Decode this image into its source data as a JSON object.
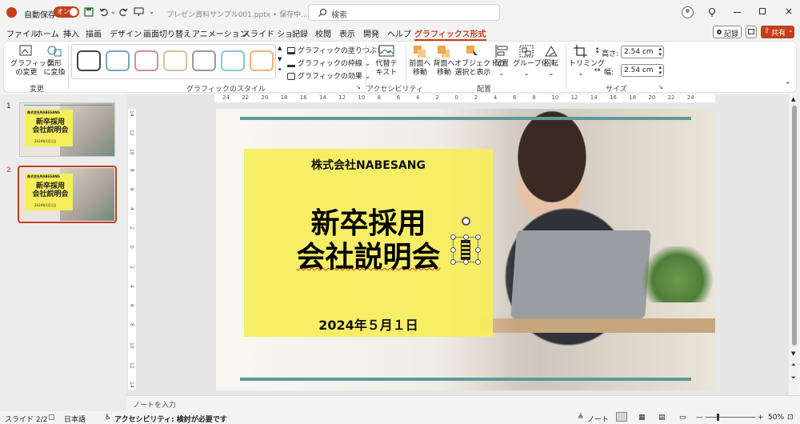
{
  "titlebar": {
    "autosave_label": "自動保存",
    "autosave_toggle": "オン",
    "doc_title": "プレゼン資料サンプル001.pptx • 保存中...",
    "search_placeholder": "検索"
  },
  "menu": {
    "tabs": [
      "ファイル",
      "ホーム",
      "挿入",
      "描画",
      "デザイン",
      "画面切り替え",
      "アニメーション",
      "スライド ショー",
      "記録",
      "校閲",
      "表示",
      "開発",
      "ヘルプ",
      "グラフィックス形式"
    ],
    "active_tab": "グラフィックス形式",
    "record_button": "記録",
    "share_button": "共有"
  },
  "ribbon": {
    "change_group": {
      "label": "変更",
      "btn1": "グラフィック\nの変更",
      "btn2": "図形\nに変換"
    },
    "styles_group": {
      "label": "グラフィックのスタイル",
      "fill": "グラフィックの塗りつぶし",
      "outline": "グラフィックの枠線",
      "effect": "グラフィックの効果"
    },
    "access_group": {
      "label": "アクセシビリティ",
      "alt_text": "代替テ\nキスト"
    },
    "arrange_group": {
      "label": "配置",
      "bring_forward": "前面へ\n移動",
      "send_backward": "背面へ\n移動",
      "selection_pane": "オブジェクトの\n選択と表示",
      "align": "配置",
      "group": "グループ化",
      "rotate": "回転"
    },
    "size_group": {
      "label": "サイズ",
      "crop": "トリミング",
      "height_label": "高さ:",
      "height_value": "2.54 cm",
      "width_label": "幅:",
      "width_value": "2.54 cm"
    }
  },
  "thumbnails": [
    {
      "number": "1",
      "company": "株式会社NABESANG",
      "title": "新卒採用\n会社説明会",
      "date": "2024年5月1日"
    },
    {
      "number": "2",
      "company": "株式会社NABESANG",
      "title": "新卒採用\n会社説明会",
      "date": "2024年5月1日"
    }
  ],
  "ruler": {
    "h_ticks": [
      "24",
      "22",
      "20",
      "18",
      "16",
      "14",
      "12",
      "10",
      "8",
      "6",
      "4",
      "2",
      "0",
      "2",
      "4",
      "6",
      "8",
      "10",
      "12",
      "14",
      "16",
      "18",
      "20",
      "22",
      "24"
    ],
    "v_ticks": [
      "14",
      "12",
      "10",
      "8",
      "6",
      "4",
      "2",
      "0",
      "2",
      "4",
      "6",
      "8",
      "10",
      "12",
      "14"
    ]
  },
  "slide": {
    "company": "株式会社NABESANG",
    "title_line1": "新卒採用",
    "title_line2": "会社説明会",
    "date": "2024年５月１日"
  },
  "notes_placeholder": "ノートを入力",
  "status": {
    "slide_count": "スライド 2/2",
    "language": "日本語",
    "accessibility": "アクセシビリティ: 検討が必要です",
    "notes_btn": "ノート",
    "zoom": "50%"
  },
  "colors": {
    "accent": "#c43e1c",
    "banner_yellow": "#f6ee5a",
    "teal_bar": "#5b9b98"
  }
}
